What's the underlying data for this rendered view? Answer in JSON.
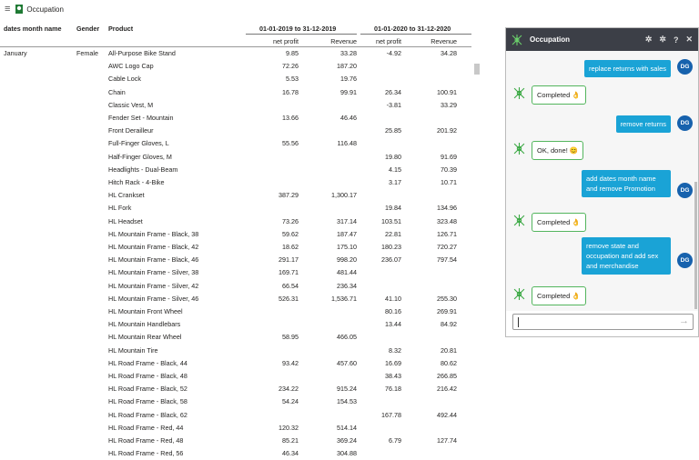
{
  "app": {
    "title": "Occupation"
  },
  "table": {
    "headers": {
      "dates_month_name": "dates month name",
      "gender": "Gender",
      "product": "Product"
    },
    "period1": "01-01-2019 to 31-12-2019",
    "period2": "01-01-2020 to 31-12-2020",
    "subheaders": [
      "net profit",
      "Revenue",
      "net profit",
      "Revenue"
    ],
    "rows": [
      {
        "m": "January",
        "g": "Female",
        "p": "All-Purpose Bike Stand",
        "a": "9.85",
        "b": "33.28",
        "c": "-4.92",
        "d": "34.28"
      },
      {
        "m": "",
        "g": "",
        "p": "AWC Logo Cap",
        "a": "72.26",
        "b": "187.20",
        "c": "",
        "d": ""
      },
      {
        "m": "",
        "g": "",
        "p": "Cable Lock",
        "a": "5.53",
        "b": "19.76",
        "c": "",
        "d": ""
      },
      {
        "m": "",
        "g": "",
        "p": "Chain",
        "a": "16.78",
        "b": "99.91",
        "c": "26.34",
        "d": "100.91"
      },
      {
        "m": "",
        "g": "",
        "p": "Classic Vest, M",
        "a": "",
        "b": "",
        "c": "-3.81",
        "d": "33.29"
      },
      {
        "m": "",
        "g": "",
        "p": "Fender Set - Mountain",
        "a": "13.66",
        "b": "46.46",
        "c": "",
        "d": ""
      },
      {
        "m": "",
        "g": "",
        "p": "Front Derailleur",
        "a": "",
        "b": "",
        "c": "25.85",
        "d": "201.92"
      },
      {
        "m": "",
        "g": "",
        "p": "Full-Finger Gloves, L",
        "a": "55.56",
        "b": "116.48",
        "c": "",
        "d": ""
      },
      {
        "m": "",
        "g": "",
        "p": "Half-Finger Gloves, M",
        "a": "",
        "b": "",
        "c": "19.80",
        "d": "91.69"
      },
      {
        "m": "",
        "g": "",
        "p": "Headlights - Dual-Beam",
        "a": "",
        "b": "",
        "c": "4.15",
        "d": "70.39"
      },
      {
        "m": "",
        "g": "",
        "p": "Hitch Rack - 4-Bike",
        "a": "",
        "b": "",
        "c": "3.17",
        "d": "10.71"
      },
      {
        "m": "",
        "g": "",
        "p": "HL Crankset",
        "a": "387.29",
        "b": "1,300.17",
        "c": "",
        "d": ""
      },
      {
        "m": "",
        "g": "",
        "p": "HL Fork",
        "a": "",
        "b": "",
        "c": "19.84",
        "d": "134.96"
      },
      {
        "m": "",
        "g": "",
        "p": "HL Headset",
        "a": "73.26",
        "b": "317.14",
        "c": "103.51",
        "d": "323.48"
      },
      {
        "m": "",
        "g": "",
        "p": "HL Mountain Frame - Black, 38",
        "a": "59.62",
        "b": "187.47",
        "c": "22.81",
        "d": "126.71"
      },
      {
        "m": "",
        "g": "",
        "p": "HL Mountain Frame - Black, 42",
        "a": "18.62",
        "b": "175.10",
        "c": "180.23",
        "d": "720.27"
      },
      {
        "m": "",
        "g": "",
        "p": "HL Mountain Frame - Black, 46",
        "a": "291.17",
        "b": "998.20",
        "c": "236.07",
        "d": "797.54"
      },
      {
        "m": "",
        "g": "",
        "p": "HL Mountain Frame - Silver, 38",
        "a": "169.71",
        "b": "481.44",
        "c": "",
        "d": ""
      },
      {
        "m": "",
        "g": "",
        "p": "HL Mountain Frame - Silver, 42",
        "a": "66.54",
        "b": "236.34",
        "c": "",
        "d": ""
      },
      {
        "m": "",
        "g": "",
        "p": "HL Mountain Frame - Silver, 46",
        "a": "526.31",
        "b": "1,536.71",
        "c": "41.10",
        "d": "255.30"
      },
      {
        "m": "",
        "g": "",
        "p": "HL Mountain Front Wheel",
        "a": "",
        "b": "",
        "c": "80.16",
        "d": "269.91"
      },
      {
        "m": "",
        "g": "",
        "p": "HL Mountain Handlebars",
        "a": "",
        "b": "",
        "c": "13.44",
        "d": "84.92"
      },
      {
        "m": "",
        "g": "",
        "p": "HL Mountain Rear Wheel",
        "a": "58.95",
        "b": "466.05",
        "c": "",
        "d": ""
      },
      {
        "m": "",
        "g": "",
        "p": "HL Mountain Tire",
        "a": "",
        "b": "",
        "c": "8.32",
        "d": "20.81"
      },
      {
        "m": "",
        "g": "",
        "p": "HL Road Frame - Black, 44",
        "a": "93.42",
        "b": "457.60",
        "c": "16.69",
        "d": "80.62"
      },
      {
        "m": "",
        "g": "",
        "p": "HL Road Frame - Black, 48",
        "a": "",
        "b": "",
        "c": "38.43",
        "d": "266.85"
      },
      {
        "m": "",
        "g": "",
        "p": "HL Road Frame - Black, 52",
        "a": "234.22",
        "b": "915.24",
        "c": "76.18",
        "d": "216.42"
      },
      {
        "m": "",
        "g": "",
        "p": "HL Road Frame - Black, 58",
        "a": "54.24",
        "b": "154.53",
        "c": "",
        "d": ""
      },
      {
        "m": "",
        "g": "",
        "p": "HL Road Frame - Black, 62",
        "a": "",
        "b": "",
        "c": "167.78",
        "d": "492.44"
      },
      {
        "m": "",
        "g": "",
        "p": "HL Road Frame - Red, 44",
        "a": "120.32",
        "b": "514.14",
        "c": "",
        "d": ""
      },
      {
        "m": "",
        "g": "",
        "p": "HL Road Frame - Red, 48",
        "a": "85.21",
        "b": "369.24",
        "c": "6.79",
        "d": "127.74"
      },
      {
        "m": "",
        "g": "",
        "p": "HL Road Frame - Red, 56",
        "a": "46.34",
        "b": "304.88",
        "c": "",
        "d": ""
      }
    ]
  },
  "panel": {
    "title": "Occupation",
    "user_initials": "DG",
    "messages": [
      {
        "from": "user",
        "text": "replace returns with sales"
      },
      {
        "from": "bot",
        "text": "Completed 👌"
      },
      {
        "from": "user",
        "text": "remove returns"
      },
      {
        "from": "bot",
        "text": "OK, done! 😊"
      },
      {
        "from": "user",
        "text": "add dates month name and remove Promotion"
      },
      {
        "from": "bot",
        "text": "Completed 👌"
      },
      {
        "from": "user",
        "text": "remove state and occupation and add sex and merchandise"
      },
      {
        "from": "bot",
        "text": "Completed 👌"
      }
    ],
    "input_value": "",
    "help_label": "?",
    "close_label": "✕"
  },
  "colors": {
    "accent_user": "#1aa3d6",
    "avatar": "#1762ad",
    "bot_border": "#53b55d",
    "panel_header": "#3c3f47"
  }
}
